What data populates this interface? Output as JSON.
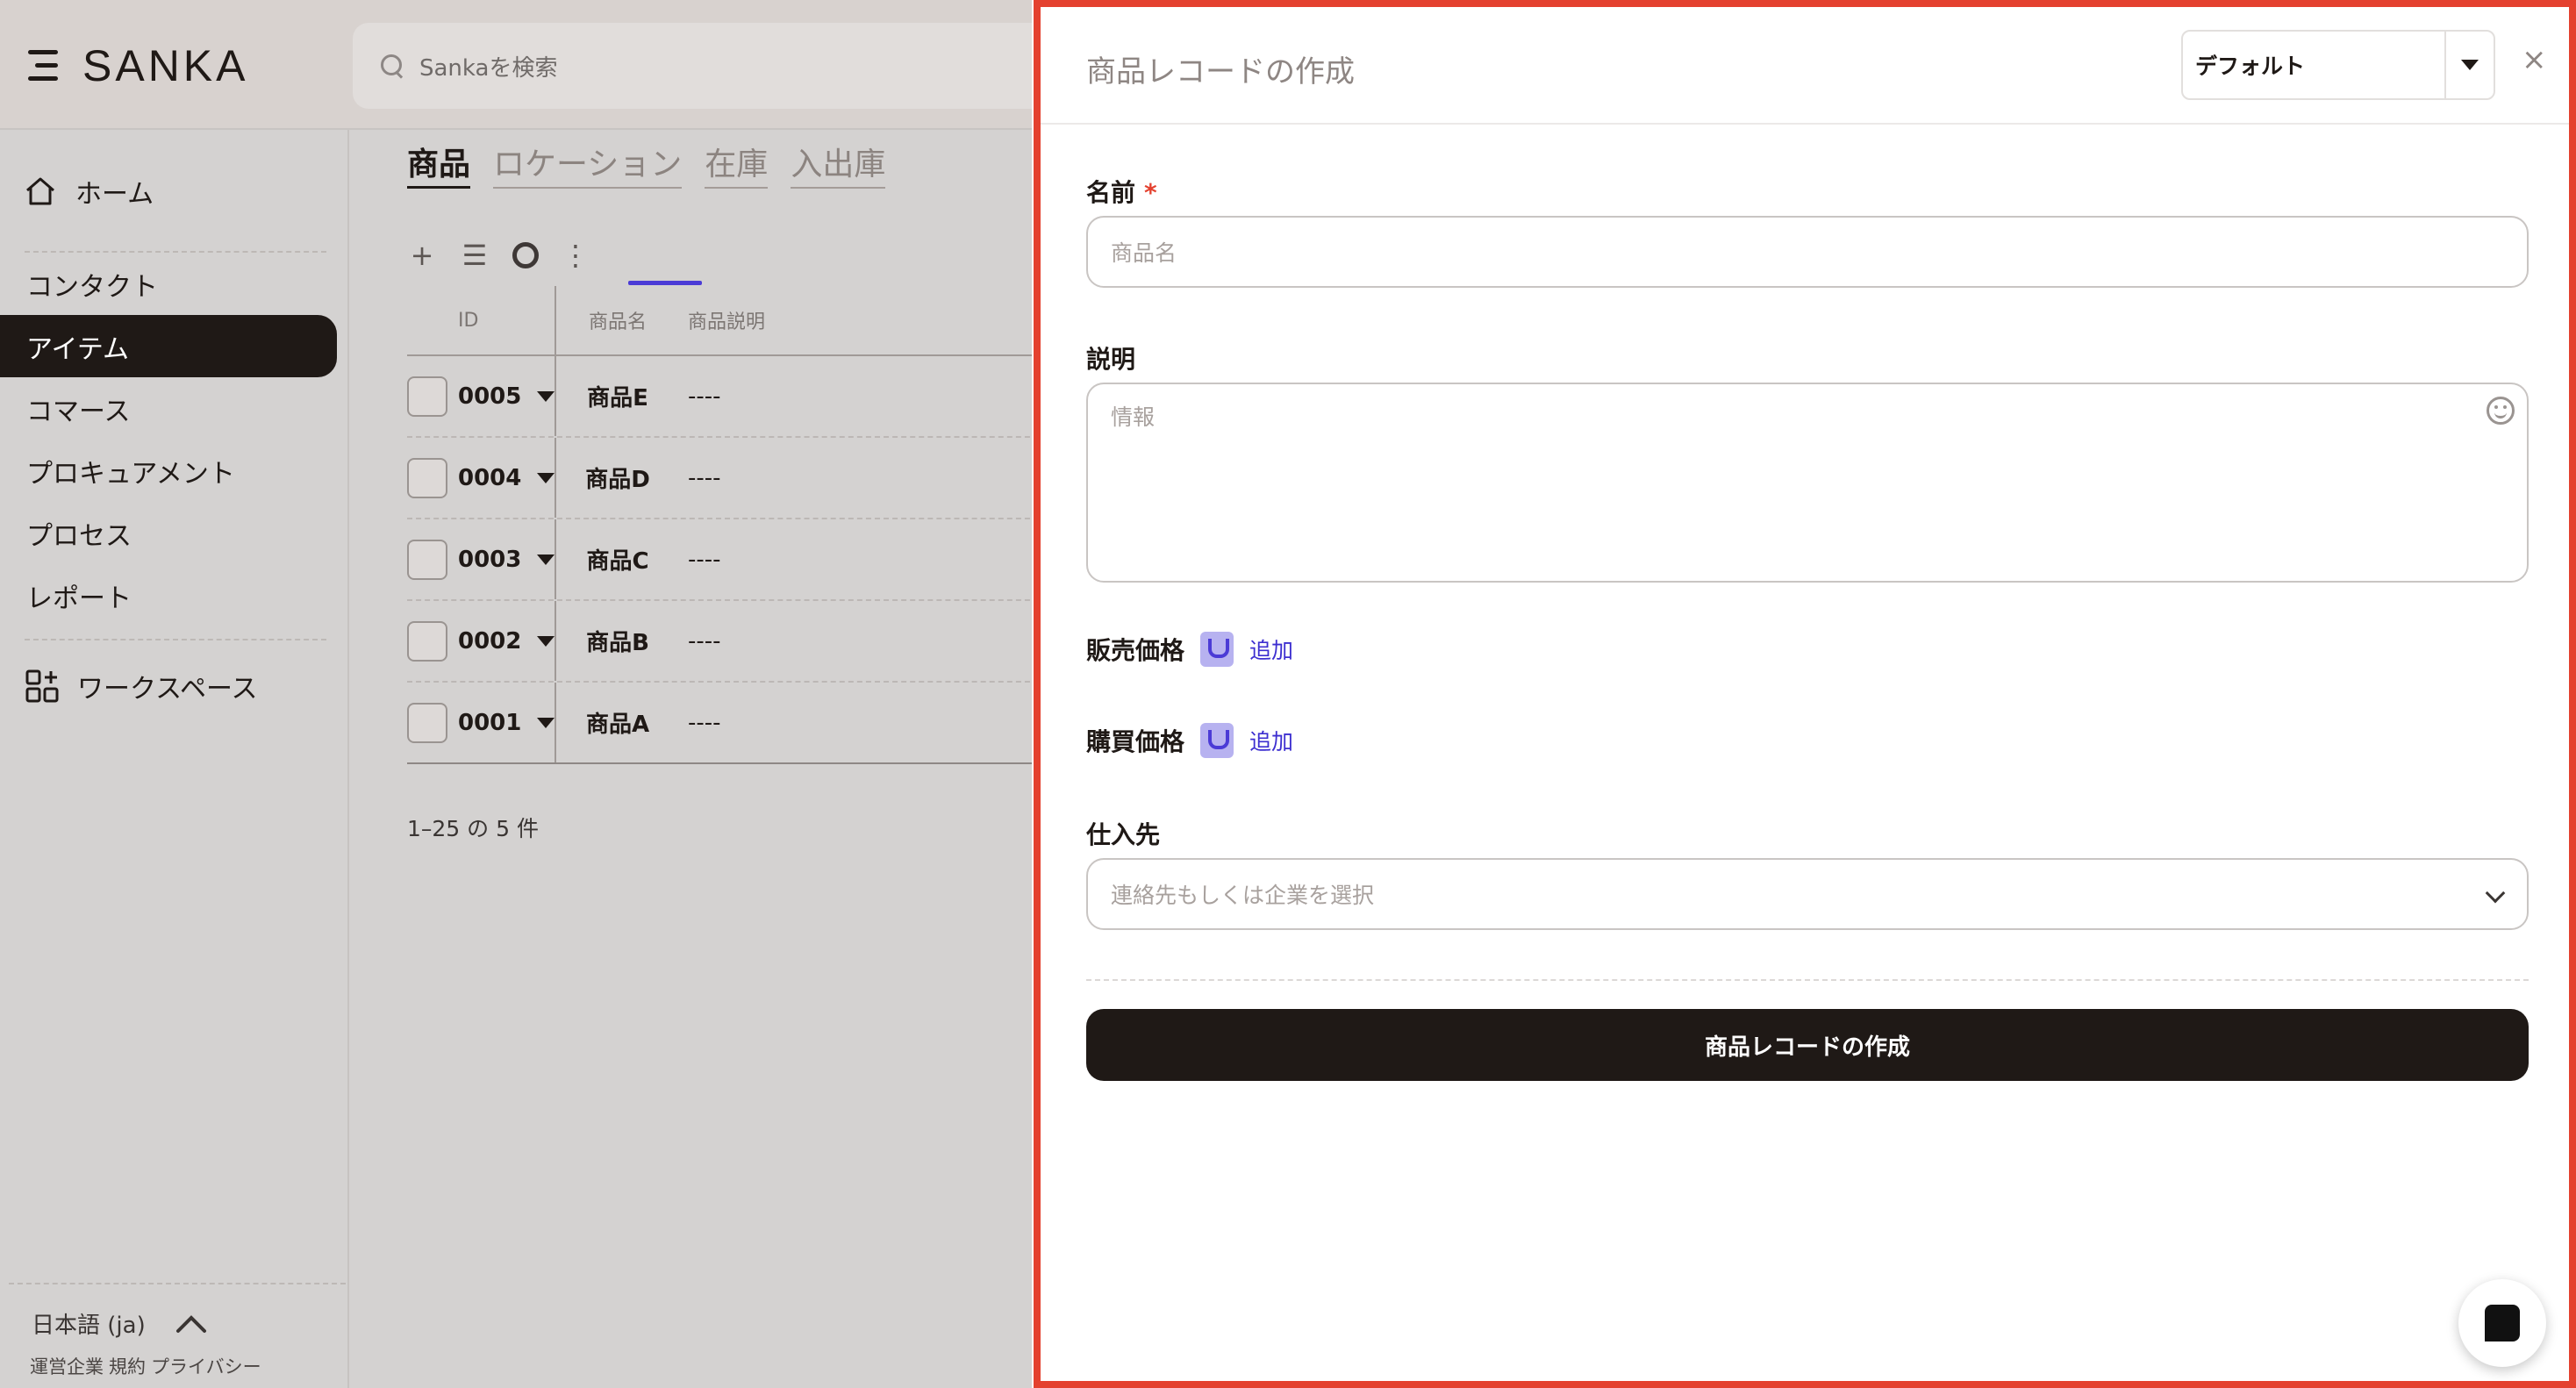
{
  "app": {
    "brand": "SANKA",
    "search_placeholder": "Sankaを検索"
  },
  "sidebar": {
    "home": "ホーム",
    "items": [
      {
        "label": "コンタクト",
        "active": false
      },
      {
        "label": "アイテム",
        "active": true
      },
      {
        "label": "コマース",
        "active": false
      },
      {
        "label": "プロキュアメント",
        "active": false
      },
      {
        "label": "プロセス",
        "active": false
      },
      {
        "label": "レポート",
        "active": false
      }
    ],
    "workspace": "ワークスペース",
    "language": "日本語 (ja)",
    "footer_links": [
      "運営企業",
      "規約",
      "プライバシー"
    ]
  },
  "main": {
    "tabs": [
      {
        "label": "商品",
        "active": true
      },
      {
        "label": "ロケーション",
        "active": false
      },
      {
        "label": "在庫",
        "active": false
      },
      {
        "label": "入出庫",
        "active": false
      }
    ],
    "toolbar": {
      "add": "+",
      "list": "☰",
      "more": "⋮"
    },
    "columns": {
      "id": "ID",
      "name": "商品名",
      "desc": "商品説明"
    },
    "rows": [
      {
        "id": "0005",
        "name": "商品E",
        "desc": "----"
      },
      {
        "id": "0004",
        "name": "商品D",
        "desc": "----"
      },
      {
        "id": "0003",
        "name": "商品C",
        "desc": "----"
      },
      {
        "id": "0002",
        "name": "商品B",
        "desc": "----"
      },
      {
        "id": "0001",
        "name": "商品A",
        "desc": "----"
      }
    ],
    "pagination": "1–25 の 5 件"
  },
  "drawer": {
    "title": "商品レコードの作成",
    "view_select": "デフォルト",
    "close": "×",
    "name_label": "名前",
    "required_mark": "*",
    "name_placeholder": "商品名",
    "desc_label": "説明",
    "desc_placeholder": "情報",
    "sale_price_label": "販売価格",
    "purchase_price_label": "購買価格",
    "add_label": "追加",
    "supplier_label": "仕入先",
    "supplier_placeholder": "連絡先もしくは企業を選択",
    "submit_label": "商品レコードの作成"
  },
  "colors": {
    "highlight_border": "#e4412f",
    "accent": "#4b3bd6",
    "dark": "#1f1916"
  }
}
